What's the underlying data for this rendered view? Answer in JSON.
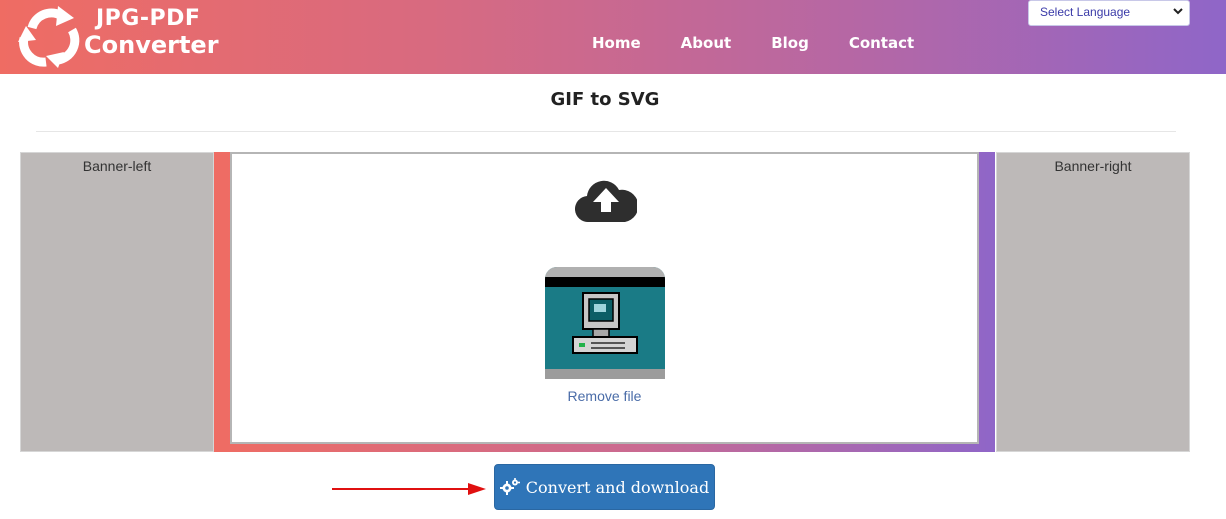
{
  "header": {
    "logo_line1": "JPG-PDF",
    "logo_line2": "Converter",
    "nav": [
      "Home",
      "About",
      "Blog",
      "Contact"
    ],
    "language_select": "Select Language"
  },
  "page": {
    "title": "GIF to SVG"
  },
  "banners": {
    "left": "Banner-left",
    "right": "Banner-right"
  },
  "upload": {
    "remove_label": "Remove file"
  },
  "actions": {
    "convert_label": "Convert and download"
  },
  "icons": {
    "logo": "recycle-arrows-icon",
    "cloud": "cloud-upload-icon",
    "thumbnail": "computer-gif-thumbnail",
    "gears": "gears-icon",
    "arrow": "arrow-right-icon"
  },
  "colors": {
    "header_gradient_start": "#ef6c63",
    "header_gradient_end": "#8f66c8",
    "convert_button": "#2f75b8",
    "link": "#4a6ca8",
    "banner_bg": "#bdb9b8",
    "annotation_arrow": "#e01010"
  }
}
